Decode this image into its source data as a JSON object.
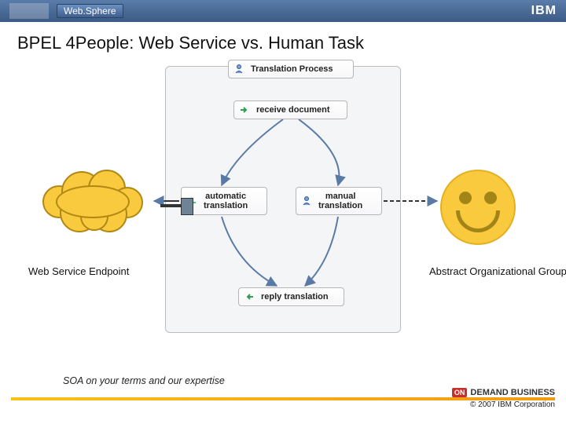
{
  "header": {
    "brand": "Web.Sphere",
    "logo_text": "IBM"
  },
  "title": "BPEL 4People: Web Service vs. Human Task",
  "diagram": {
    "process_title": "Translation Process",
    "nodes": {
      "receive": "receive document",
      "automatic": "automatic\ntranslation",
      "manual": "manual\ntranslation",
      "reply": "reply translation"
    },
    "left_endpoint": "Web Service Endpoint",
    "right_endpoint": "Abstract Organizational Group"
  },
  "footer": {
    "tagline": "SOA on your terms and our expertise",
    "on_demand_prefix": "ON",
    "on_demand_text": "DEMAND BUSINESS",
    "copyright": "© 2007 IBM Corporation"
  }
}
